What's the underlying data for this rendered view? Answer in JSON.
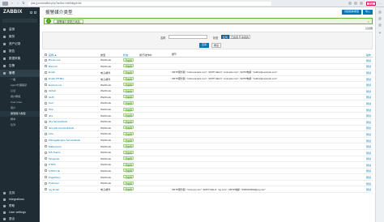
{
  "browser": {
    "url": "pba.jj.com/zabbix.php?action=mediatype.list",
    "badge": "更新",
    "more": "⋯"
  },
  "sidebar": {
    "logo": "ZABBIX",
    "search_placeholder": "",
    "items": [
      {
        "label": "监测",
        "icon": "eye-icon"
      },
      {
        "label": "服务",
        "icon": "services-icon"
      },
      {
        "label": "资产记录",
        "icon": "inventory-icon"
      },
      {
        "label": "报告",
        "icon": "report-icon"
      },
      {
        "label": "数据采集",
        "icon": "datacollection-icon"
      },
      {
        "label": "告警",
        "icon": "alert-icon"
      },
      {
        "label": "管理",
        "icon": "gear-icon"
      }
    ],
    "subitems": [
      "一般",
      "agent代理程序",
      "认证",
      "用户群组",
      "User roles",
      "用户",
      "报警媒介类型",
      "脚本",
      "队列"
    ],
    "current_subitem": 6,
    "bottom": [
      {
        "label": "支持",
        "icon": "support-icon"
      },
      {
        "label": "Integrations",
        "icon": "integrations-icon"
      },
      {
        "label": "帮助",
        "icon": "help-icon"
      },
      {
        "label": "User settings",
        "icon": "user-icon"
      },
      {
        "label": "退出",
        "icon": "logout-icon"
      }
    ]
  },
  "main": {
    "title": "报警媒介类型",
    "create_label": "创建媒体类型",
    "import_label": "导入",
    "message": "报警媒介类型已添加",
    "filter_tab": "过滤器",
    "filter": {
      "name_label": "名称",
      "status_label": "状态",
      "status_options": [
        "任何",
        "已启用",
        "停用的"
      ],
      "status_selected": 0,
      "apply_label": "应用",
      "reset_label": "重设"
    },
    "table": {
      "headers": [
        "名称 ▲",
        "类型",
        "状态",
        "用于动作中",
        "细节",
        "动作"
      ],
      "rows": [
        {
          "name": "Brevis.one",
          "type": "Webhook",
          "status": "已启用",
          "used": "",
          "details": "",
          "action": "测试"
        },
        {
          "name": "Discord",
          "type": "Webhook",
          "status": "已启用",
          "used": "",
          "details": "",
          "action": "测试"
        },
        {
          "name": "Email",
          "type": "电子邮件",
          "status": "已启用",
          "used": "",
          "details": "SMTP服务器: \"mail.example.com\", SMTP HELO: \"example.com\", SMTP电邮: \"zabbix@example.com\"",
          "action": "测试"
        },
        {
          "name": "Email (HTML)",
          "type": "电子邮件",
          "status": "已启用",
          "used": "",
          "details": "SMTP服务器: \"mail.example.com\", SMTP HELO: \"example.com\", SMTP电邮: \"zabbix@example.com\"",
          "action": "测试"
        },
        {
          "name": "Express.ms",
          "type": "Webhook",
          "status": "已启用",
          "used": "",
          "details": "",
          "action": "测试"
        },
        {
          "name": "Github",
          "type": "Webhook",
          "status": "已启用",
          "used": "",
          "details": "",
          "action": "测试"
        },
        {
          "name": "GLPi",
          "type": "Webhook",
          "status": "已启用",
          "used": "",
          "details": "",
          "action": "测试"
        },
        {
          "name": "iLert",
          "type": "Webhook",
          "status": "已启用",
          "used": "",
          "details": "",
          "action": "测试"
        },
        {
          "name": "iTop",
          "type": "Webhook",
          "status": "已启用",
          "used": "",
          "details": "",
          "action": "测试"
        },
        {
          "name": "Jira",
          "type": "Webhook",
          "status": "已启用",
          "used": "",
          "details": "",
          "action": "测试"
        },
        {
          "name": "Jira ServiceDesk",
          "type": "Webhook",
          "status": "已启用",
          "used": "",
          "details": "",
          "action": "测试"
        },
        {
          "name": "Jira with CustomFields",
          "type": "Webhook",
          "status": "已启用",
          "used": "",
          "details": "",
          "action": "测试"
        },
        {
          "name": "Line",
          "type": "Webhook",
          "status": "已启用",
          "used": "",
          "details": "",
          "action": "测试"
        },
        {
          "name": "ManageEngine ServiceDesk",
          "type": "Webhook",
          "status": "已启用",
          "used": "",
          "details": "",
          "action": "测试"
        },
        {
          "name": "Mattermost",
          "type": "Webhook",
          "status": "已启用",
          "used": "",
          "details": "",
          "action": "测试"
        },
        {
          "name": "MS Teams",
          "type": "Webhook",
          "status": "已启用",
          "used": "",
          "details": "",
          "action": "测试"
        },
        {
          "name": "Opsgenie",
          "type": "Webhook",
          "status": "已启用",
          "used": "",
          "details": "",
          "action": "测试"
        },
        {
          "name": "OTRS",
          "type": "Webhook",
          "status": "已启用",
          "used": "",
          "details": "",
          "action": "测试"
        },
        {
          "name": "OTRS CE",
          "type": "Webhook",
          "status": "已启用",
          "used": "",
          "details": "",
          "action": "测试"
        },
        {
          "name": "PagerDuty",
          "type": "Webhook",
          "status": "已启用",
          "used": "",
          "details": "",
          "action": "测试"
        },
        {
          "name": "Pushover",
          "type": "Webhook",
          "status": "已启用",
          "used": "",
          "details": "",
          "action": "测试"
        },
        {
          "name": "qq_Email",
          "type": "电子邮件",
          "status": "已启用",
          "used": "",
          "details": "SMTP服务器: \"smtp.qq.com\", SMTP HELO: \"qq.com\", SMTP电邮: \"3035034990@qq.com\"",
          "action": "测试"
        }
      ]
    }
  }
}
